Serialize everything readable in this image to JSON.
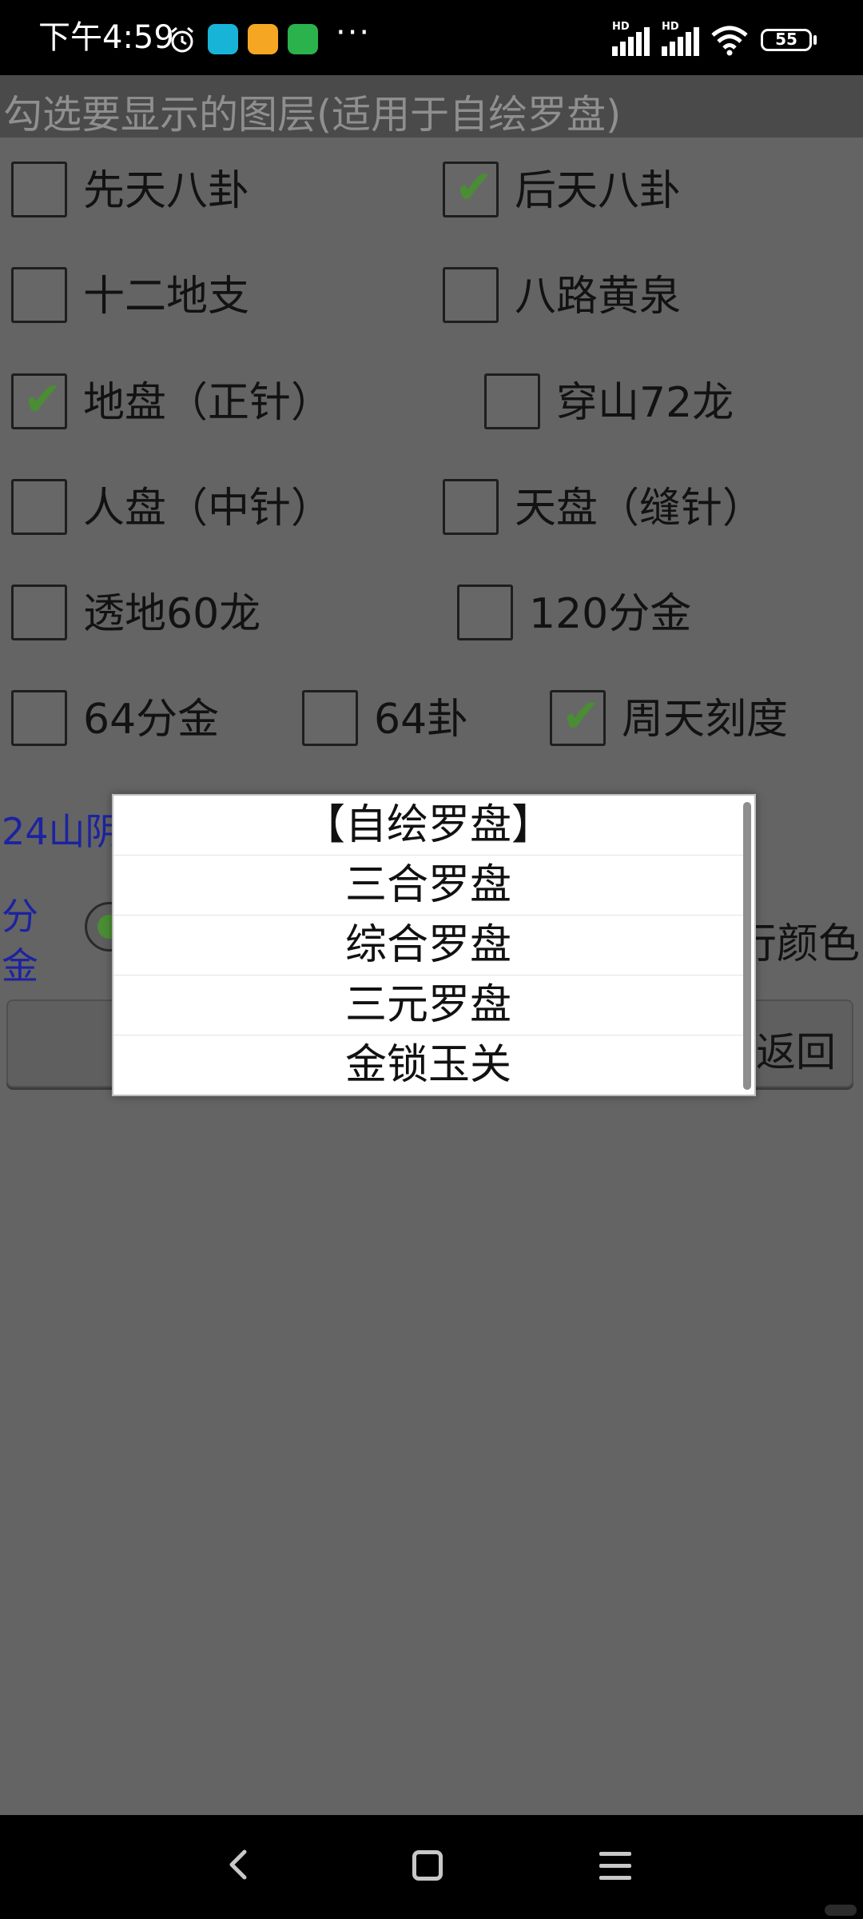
{
  "status_bar": {
    "time": "下午4:59",
    "dots": "···",
    "battery": "55"
  },
  "header": {
    "title": "勾选要显示的图层(适用于自绘罗盘)"
  },
  "layers": [
    {
      "label": "先天八卦",
      "checked": false
    },
    {
      "label": "后天八卦",
      "checked": true
    },
    {
      "label": "十二地支",
      "checked": false
    },
    {
      "label": "八路黄泉",
      "checked": false
    },
    {
      "label": "地盘（正针）",
      "checked": true
    },
    {
      "label": "穿山72龙",
      "checked": false
    },
    {
      "label": "人盘（中针）",
      "checked": false
    },
    {
      "label": "天盘（缝针）",
      "checked": false
    },
    {
      "label": "透地60龙",
      "checked": false
    },
    {
      "label": "120分金",
      "checked": false
    },
    {
      "label": "64分金",
      "checked": false
    },
    {
      "label": "64卦",
      "checked": false
    },
    {
      "label": "周天刻度",
      "checked": true
    }
  ],
  "background": {
    "label_24": "24山阴",
    "fenjin_1": "分",
    "fenjin_2": "金",
    "color_label": "行颜色",
    "back_button": "返回"
  },
  "popup": {
    "items": [
      "【自绘罗盘】",
      "三合罗盘",
      "综合罗盘",
      "三元罗盘",
      "金锁玉关"
    ]
  },
  "colors": {
    "check": "#4a8d34",
    "blue_label": "#1c23a0"
  }
}
